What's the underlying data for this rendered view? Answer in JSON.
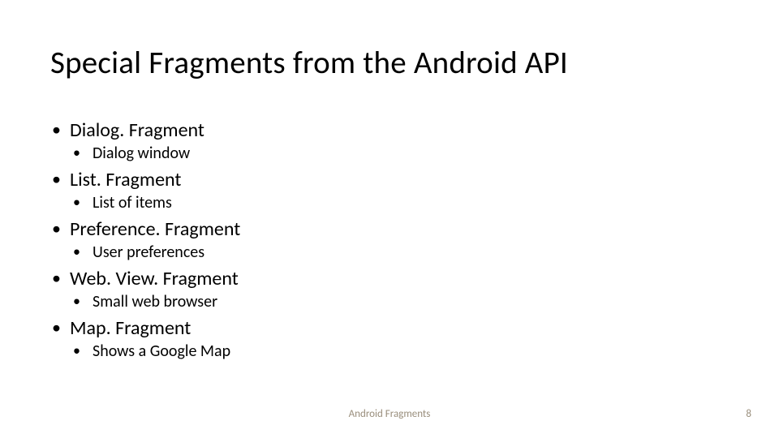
{
  "title": "Special Fragments from the Android API",
  "items": [
    {
      "label": "Dialog. Fragment",
      "sub": "Dialog window"
    },
    {
      "label": "List. Fragment",
      "sub": "List of items"
    },
    {
      "label": "Preference. Fragment",
      "sub": "User preferences"
    },
    {
      "label": "Web. View. Fragment",
      "sub": "Small web browser"
    },
    {
      "label": "Map. Fragment",
      "sub": "Shows a Google Map"
    }
  ],
  "footer": {
    "center": "Android Fragments",
    "page": "8"
  }
}
